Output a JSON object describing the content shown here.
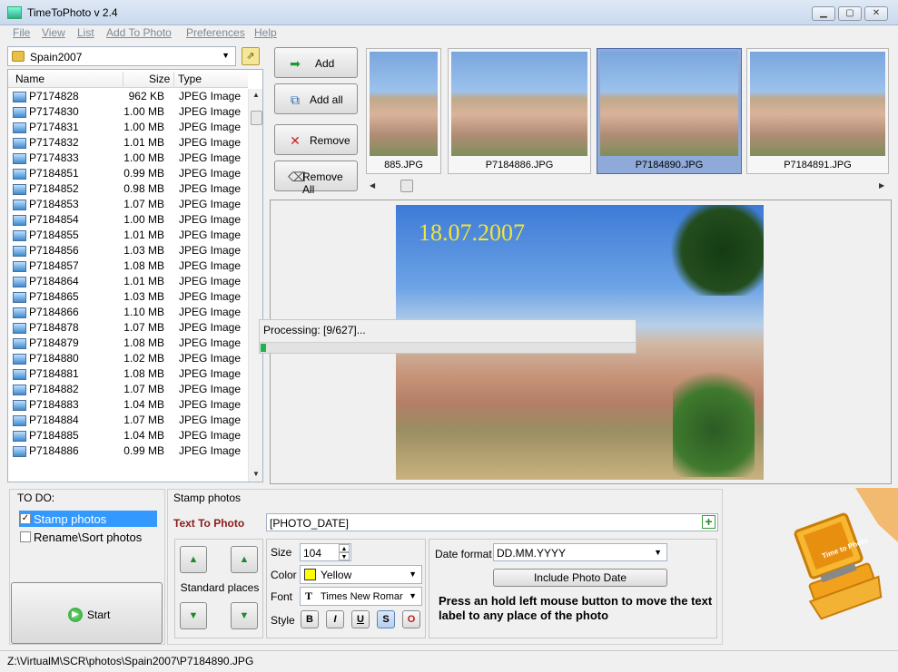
{
  "window": {
    "title": "TimeToPhoto v 2.4",
    "min": "▁",
    "max": "▢",
    "close": "✕"
  },
  "menu": [
    "File",
    "View",
    "List",
    "Add To Photo",
    "Preferences",
    "Help"
  ],
  "folder": {
    "name": "Spain2007"
  },
  "filelist": {
    "headers": {
      "name": "Name",
      "size": "Size",
      "type": "Type"
    },
    "rows": [
      {
        "name": "P7174828",
        "size": "962 KB",
        "type": "JPEG Image"
      },
      {
        "name": "P7174830",
        "size": "1.00 MB",
        "type": "JPEG Image"
      },
      {
        "name": "P7174831",
        "size": "1.00 MB",
        "type": "JPEG Image"
      },
      {
        "name": "P7174832",
        "size": "1.01 MB",
        "type": "JPEG Image"
      },
      {
        "name": "P7174833",
        "size": "1.00 MB",
        "type": "JPEG Image"
      },
      {
        "name": "P7184851",
        "size": "0.99 MB",
        "type": "JPEG Image"
      },
      {
        "name": "P7184852",
        "size": "0.98 MB",
        "type": "JPEG Image"
      },
      {
        "name": "P7184853",
        "size": "1.07 MB",
        "type": "JPEG Image"
      },
      {
        "name": "P7184854",
        "size": "1.00 MB",
        "type": "JPEG Image"
      },
      {
        "name": "P7184855",
        "size": "1.01 MB",
        "type": "JPEG Image"
      },
      {
        "name": "P7184856",
        "size": "1.03 MB",
        "type": "JPEG Image"
      },
      {
        "name": "P7184857",
        "size": "1.08 MB",
        "type": "JPEG Image"
      },
      {
        "name": "P7184864",
        "size": "1.01 MB",
        "type": "JPEG Image"
      },
      {
        "name": "P7184865",
        "size": "1.03 MB",
        "type": "JPEG Image"
      },
      {
        "name": "P7184866",
        "size": "1.10 MB",
        "type": "JPEG Image"
      },
      {
        "name": "P7184878",
        "size": "1.07 MB",
        "type": "JPEG Image"
      },
      {
        "name": "P7184879",
        "size": "1.08 MB",
        "type": "JPEG Image"
      },
      {
        "name": "P7184880",
        "size": "1.02 MB",
        "type": "JPEG Image"
      },
      {
        "name": "P7184881",
        "size": "1.08 MB",
        "type": "JPEG Image"
      },
      {
        "name": "P7184882",
        "size": "1.07 MB",
        "type": "JPEG Image"
      },
      {
        "name": "P7184883",
        "size": "1.04 MB",
        "type": "JPEG Image"
      },
      {
        "name": "P7184884",
        "size": "1.07 MB",
        "type": "JPEG Image"
      },
      {
        "name": "P7184885",
        "size": "1.04 MB",
        "type": "JPEG Image"
      },
      {
        "name": "P7184886",
        "size": "0.99 MB",
        "type": "JPEG Image"
      }
    ]
  },
  "actions": {
    "add": "Add",
    "add_all": "Add all",
    "remove": "Remove",
    "remove_all": "Remove All"
  },
  "thumbnails": [
    {
      "label": "885.JPG",
      "selected": false
    },
    {
      "label": "P7184886.JPG",
      "selected": false
    },
    {
      "label": "P7184890.JPG",
      "selected": true
    },
    {
      "label": "P7184891.JPG",
      "selected": false
    }
  ],
  "preview": {
    "stamp_text": "18.07.2007"
  },
  "processing": {
    "text": "Processing: [9/627]...",
    "progress": 0.0144
  },
  "todo": {
    "title": "TO DO:",
    "items": [
      {
        "label": "Stamp photos",
        "checked": true,
        "selected": true
      },
      {
        "label": "Rename\\Sort photos",
        "checked": false,
        "selected": false
      }
    ],
    "start": "Start"
  },
  "stamp": {
    "title": "Stamp photos",
    "text_label": "Text To Photo",
    "text_value": "[PHOTO_DATE]",
    "standard_places": "Standard places",
    "size_label": "Size",
    "size_value": "104",
    "color_label": "Color",
    "color_value": "Yellow",
    "color_hex": "#ffff00",
    "font_label": "Font",
    "font_value": "Times New Romar",
    "style_label": "Style",
    "style_buttons": [
      "B",
      "I",
      "U",
      "S",
      "O"
    ],
    "date_format_label": "Date format",
    "date_format_value": "DD.MM.YYYY",
    "include_button": "Include Photo Date",
    "help": "Press an hold left mouse button to move the text label to any place of the photo"
  },
  "status": {
    "path": "Z:\\VirtualM\\SCR\\photos\\Spain2007\\P7184890.JPG"
  },
  "logo": {
    "text": "Time to Photo"
  }
}
